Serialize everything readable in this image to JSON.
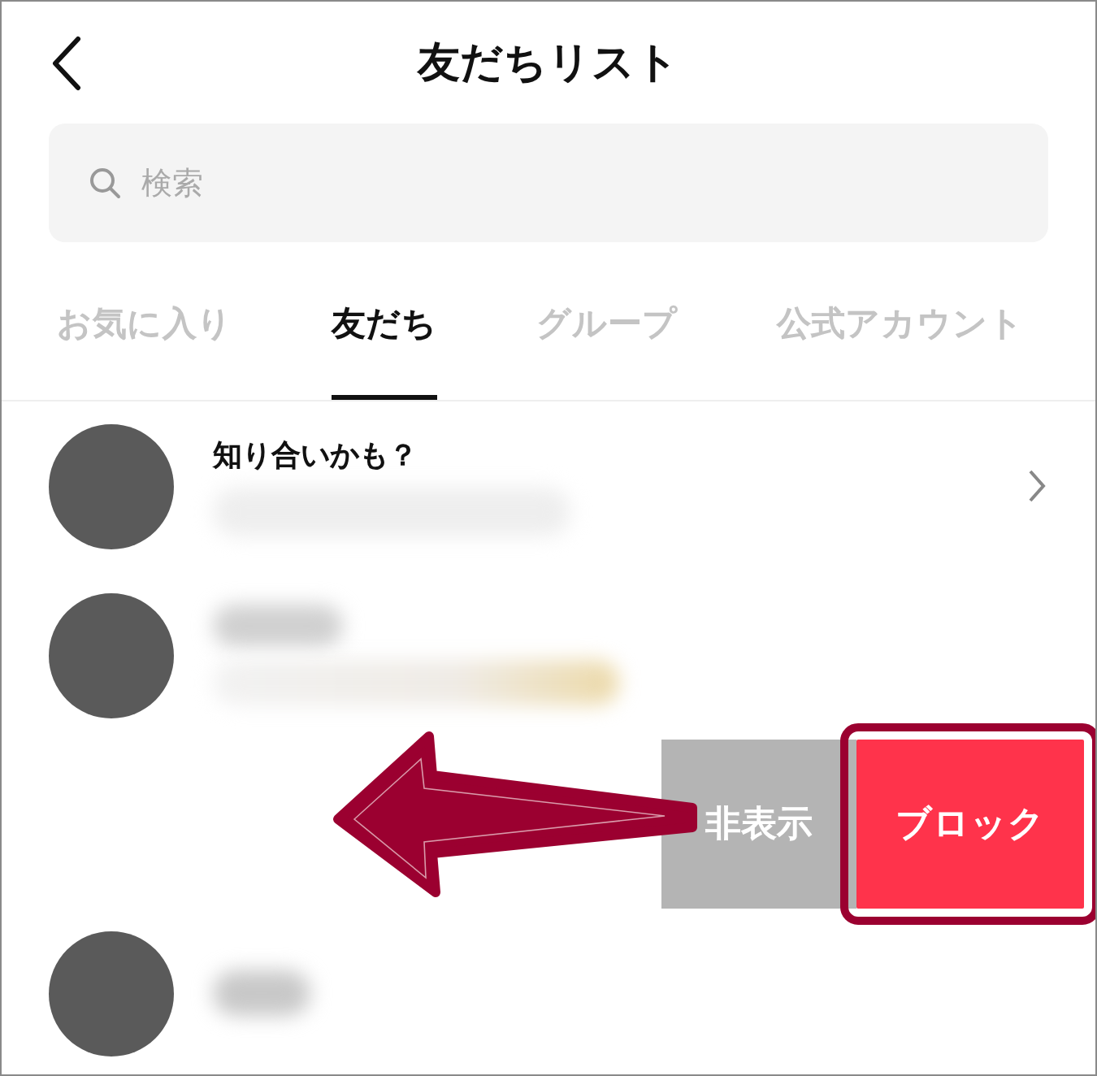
{
  "header": {
    "title": "友だちリスト"
  },
  "search": {
    "placeholder": "検索"
  },
  "tabs": [
    {
      "label": "お気に入り",
      "selected": false
    },
    {
      "label": "友だち",
      "selected": true
    },
    {
      "label": "グループ",
      "selected": false
    },
    {
      "label": "公式アカウント",
      "selected": false
    }
  ],
  "rows": [
    {
      "kind": "suggestion",
      "title": "知り合いかも？"
    },
    {
      "kind": "friend"
    },
    {
      "kind": "swiped",
      "swipe_arrow": true,
      "actions": [
        {
          "label": "非表示",
          "kind": "hide",
          "highlighted": false
        },
        {
          "label": "ブロック",
          "kind": "block",
          "highlighted": true
        }
      ]
    },
    {
      "kind": "friend"
    }
  ]
}
